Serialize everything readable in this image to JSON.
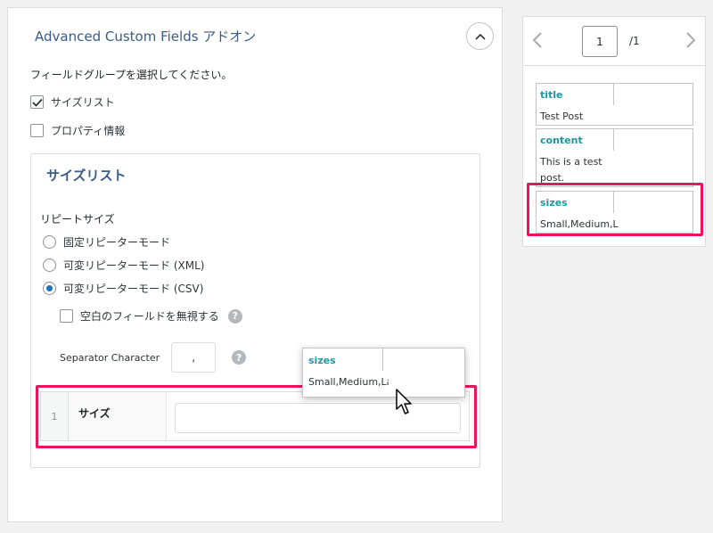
{
  "panel": {
    "title": "Advanced Custom Fields アドオン",
    "prompt": "フィールドグループを選択してください。",
    "groups": [
      {
        "label": "サイズリスト",
        "checked": true
      },
      {
        "label": "プロパティ情報",
        "checked": false
      }
    ]
  },
  "group_box": {
    "title": "サイズリスト",
    "mode_label": "リピートサイズ",
    "modes": [
      {
        "label": "固定リピーターモード",
        "selected": false
      },
      {
        "label": "可変リピーターモード (XML)",
        "selected": false
      },
      {
        "label": "可変リピーターモード (CSV)",
        "selected": true
      }
    ],
    "ignore_empty_label": "空白のフィールドを無視する",
    "separator_label": "Separator Character",
    "separator_value": ",",
    "repeater": {
      "index": "1",
      "label": "サイズ",
      "value": ""
    }
  },
  "pager": {
    "current": "1",
    "total": "/1"
  },
  "fields": [
    {
      "name": "title",
      "value": "Test Post"
    },
    {
      "name": "content",
      "value": "This is a test post."
    },
    {
      "name": "sizes",
      "value": "Small,Medium,La"
    }
  ],
  "drag_preview": {
    "name": "sizes",
    "value": "Small,Medium,La"
  },
  "colors": {
    "highlight": "#e6175d",
    "field_name": "#1a9aa0",
    "title": "#3a5c89",
    "radio": "#2271b1"
  },
  "icons": {
    "collapse": "chevron-up-icon",
    "help": "question-icon",
    "prev": "chevron-left-icon",
    "next": "chevron-right-icon",
    "cursor": "mouse-pointer-icon"
  }
}
